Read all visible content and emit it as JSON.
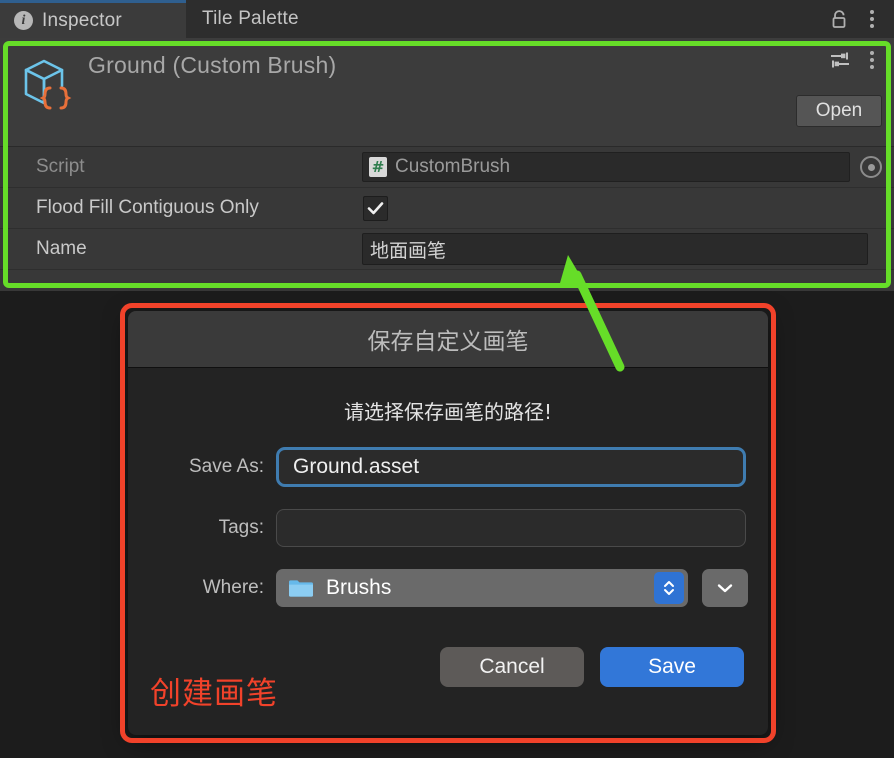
{
  "tabs": [
    {
      "label": "Inspector",
      "icon": "info-icon",
      "active": true
    },
    {
      "label": "Tile Palette",
      "icon": "",
      "active": false
    }
  ],
  "window_controls": {
    "lock_icon": "unlock-icon",
    "menu_icon": "kebab-menu-icon"
  },
  "inspector": {
    "asset_title": "Ground (Custom Brush)",
    "asset_icon": "custom-brush-asset-icon",
    "preset_icon": "preset-sliders-icon",
    "menu_icon": "kebab-menu-icon",
    "open_label": "Open",
    "properties": [
      {
        "label": "Script",
        "type": "object-field",
        "value": "CustomBrush",
        "value_icon": "csharp-script-icon",
        "picker_icon": "object-picker-icon"
      },
      {
        "label": "Flood Fill Contiguous Only",
        "type": "checkbox",
        "checked": true
      },
      {
        "label": "Name",
        "type": "text-field",
        "value": "地面画笔"
      }
    ]
  },
  "dialog": {
    "title": "保存自定义画笔",
    "message": "请选择保存画笔的路径!",
    "fields": {
      "save_as_label": "Save As:",
      "save_as_value": "Ground.asset",
      "tags_label": "Tags:",
      "tags_value": "",
      "where_label": "Where:",
      "where_value": "Brushs",
      "where_icon": "folder-icon",
      "stepper_icon": "up-down-chevron-icon",
      "disclosure_icon": "chevron-down-icon"
    },
    "buttons": {
      "cancel": "Cancel",
      "save": "Save"
    }
  },
  "annotations": {
    "red_label": "创建画笔",
    "green_box_color": "#66dd28",
    "red_box_color": "#f1422a",
    "arrow_color": "#66dd28"
  }
}
